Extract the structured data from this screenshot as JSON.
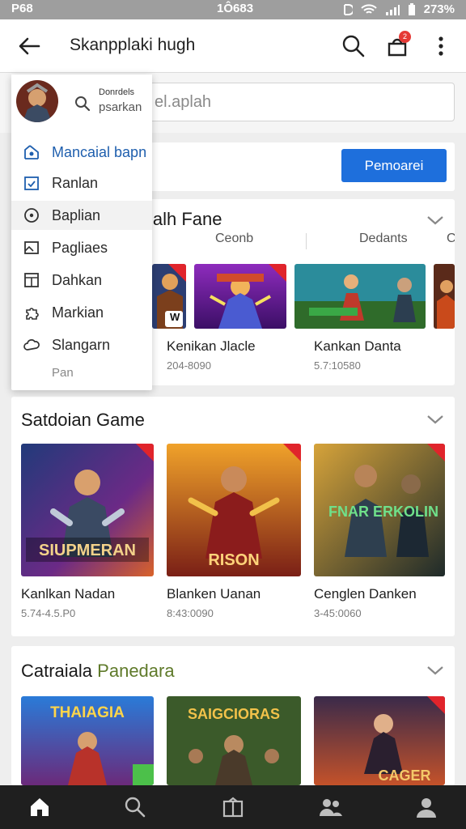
{
  "status_bar": {
    "left": "P68",
    "time": "1Ô683",
    "battery": "273%"
  },
  "app_bar": {
    "title": "Skanpplaki hugh",
    "notification_count": "2"
  },
  "search": {
    "placeholder": "el.aplah"
  },
  "banner": {
    "button_label": "Pemoarei"
  },
  "drawer": {
    "header_line1": "Donrdels",
    "header_line2": "psarkan",
    "items": [
      {
        "label": "Mancaial bapn",
        "icon": "dashboard-icon",
        "active": true
      },
      {
        "label": "Ranlan",
        "icon": "calendar-icon"
      },
      {
        "label": "Baplian",
        "icon": "target-icon",
        "highlighted": true
      },
      {
        "label": "Pagliaes",
        "icon": "image-icon"
      },
      {
        "label": "Dahkan",
        "icon": "layout-icon"
      },
      {
        "label": "Markian",
        "icon": "puzzle-icon"
      },
      {
        "label": "Slangarn",
        "icon": "cloud-icon"
      }
    ],
    "footer": "Pan"
  },
  "section1": {
    "title": "lalh Fane",
    "tabs": [
      "Ceonb",
      "Dedants",
      "C"
    ],
    "games": [
      {
        "name": "",
        "meta": "",
        "badge": "W"
      },
      {
        "name": "Kenikan Jlacle",
        "meta": "204-8090"
      },
      {
        "name": "Kankan Danta",
        "meta": "5.7:10580"
      }
    ]
  },
  "section2": {
    "title": "Satdoian Game",
    "games": [
      {
        "name": "Kanlkan Nadan",
        "meta": "5.74-4.5.P0",
        "art_text": "SIUPMERAN"
      },
      {
        "name": "Blanken Uanan",
        "meta": "8:43:0090",
        "art_text": "RISON"
      },
      {
        "name": "Cenglen Danken",
        "meta": "3-45:0060",
        "art_text": "FNAR ERKOLIN"
      }
    ]
  },
  "section3": {
    "title_part1": "Catraiala",
    "title_part2": "Panedara",
    "games": [
      {
        "art_text": "THAIAGIA"
      },
      {
        "art_text": "SAIGCIORAS"
      },
      {
        "art_text": "CAGER"
      }
    ]
  },
  "bottom_nav": [
    "home-icon",
    "search-icon",
    "gift-icon",
    "friends-icon",
    "profile-icon"
  ],
  "colors": {
    "accent": "#1e6fdc",
    "badge": "#e53935",
    "navbar": "#1f1f1f"
  }
}
